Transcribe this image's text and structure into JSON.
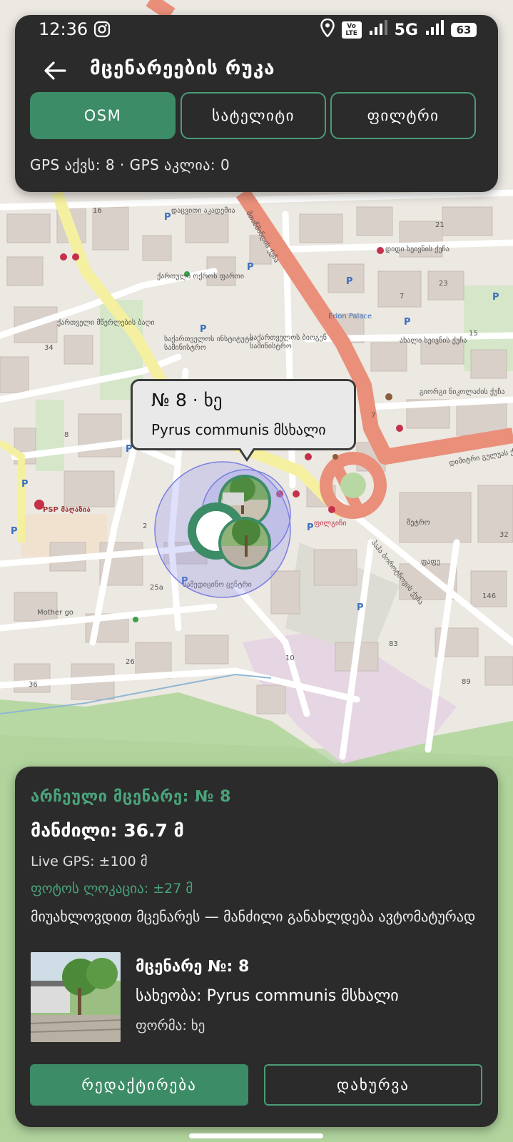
{
  "status_bar": {
    "time": "12:36",
    "network": "5G",
    "volte_label": "Vo LTE",
    "battery": "63",
    "icons": [
      "instagram-icon",
      "location-icon",
      "volte-icon",
      "signal-icon",
      "signal-icon",
      "battery-icon"
    ]
  },
  "app_bar": {
    "title": "მცენარეების რუკა",
    "back_icon": "arrow-left-icon"
  },
  "map_tabs": [
    {
      "label": "OSM",
      "active": true
    },
    {
      "label": "სატელიტი",
      "active": false
    },
    {
      "label": "ფილტრი",
      "active": false
    }
  ],
  "gps_summary": "GPS აქვს: 8 · GPS აკლია: 0",
  "map": {
    "labels": [
      "მთაწმინდის ქუჩა",
      "დიდი ხეივნის ქუჩა",
      "ახალი ხეივნის ქუჩა",
      "გიორგი ნიკოლაძის ქუჩა",
      "დიმიტრი გულუას ქუჩა",
      "პაჰა ბოროტნოვის ქუჩა",
      "ქართული ოქროს ფართი",
      "ქართველი მწერლების ბაღი",
      "საქართველოს ინსტიტუტი სამინისტრო",
      "საქართველოს ბიოგენ სამინისტრო",
      "PSP მაღაზია",
      "Mother go",
      "Erion Palace",
      "სამედიცინო ცენტრი",
      "ფილგიჩი",
      "მეტრო",
      "ფაფუ",
      "დაცვითი აკადემია"
    ],
    "numbers": [
      "34",
      "16",
      "7",
      "23",
      "8",
      "2",
      "25a",
      "26",
      "36",
      "83",
      "10",
      "89",
      "146",
      "32",
      "7",
      "15",
      "21"
    ],
    "accent": "#3d8c68",
    "route_color": "#e98f7a"
  },
  "selected_marker": {
    "title": "№ 8 · ხე",
    "subtitle": "Pyrus communis მსხალი"
  },
  "bottom_sheet": {
    "heading": "არჩეული მცენარე: № 8",
    "distance": "მანძილი: 36.7 მ",
    "live_gps": "Live GPS: ±100 მ",
    "photo_location": "ფოტოს ლოკაცია: ±27 მ",
    "hint": "მიუახლოვდით მცენარეს — მანძილი განახლდება ავტომატურად",
    "plant_no": "მცენარე №: 8",
    "species": "სახეობა: Pyrus communis მსხალი",
    "form": "ფორმა: ხე",
    "edit_button": "რედაქტირება",
    "close_button": "დახურვა"
  },
  "colors": {
    "panel": "#2b2b2b",
    "accent": "#3d8c68",
    "accent_text": "#4aa37a"
  }
}
